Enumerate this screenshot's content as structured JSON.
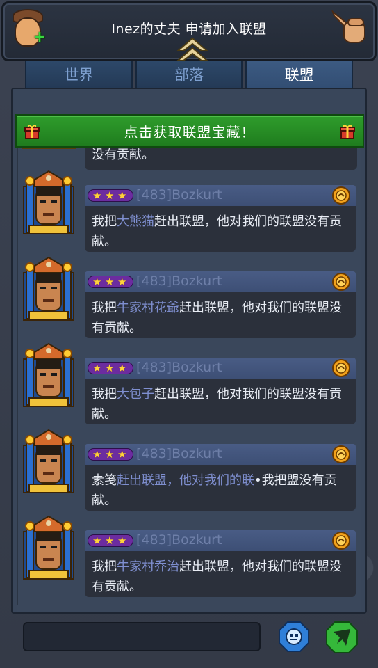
{
  "header": {
    "title": "Inez的丈夫 申请加入联盟"
  },
  "tabs": [
    {
      "label": "世界",
      "active": false
    },
    {
      "label": "部落",
      "active": false
    },
    {
      "label": "联盟",
      "active": true
    }
  ],
  "banner": {
    "label": "点击获取联盟宝藏！"
  },
  "partial_message": {
    "text": "没有贡献。"
  },
  "messages": [
    {
      "sender": "[483]Bozkurt",
      "stars": 3,
      "prefix": "我把",
      "highlight": "大熊猫",
      "suffix": "赶出联盟，他对我们的联盟没有贡献。"
    },
    {
      "sender": "[483]Bozkurt",
      "stars": 3,
      "prefix": "我把",
      "highlight": "牛家村花爺",
      "suffix": "赶出联盟，他对我们的联盟没有贡献。"
    },
    {
      "sender": "[483]Bozkurt",
      "stars": 3,
      "prefix": "我把",
      "highlight": "大包子",
      "suffix": "赶出联盟，他对我们的联盟没有贡献。"
    },
    {
      "sender": "[483]Bozkurt",
      "stars": 3,
      "prefix": "素笺",
      "highlight": "赶出联盟，他对我们的联",
      "suffix": "•我把盟没有贡献。"
    },
    {
      "sender": "[483]Bozkurt",
      "stars": 3,
      "prefix": "我把",
      "highlight": "牛家村乔治",
      "suffix": "赶出联盟，他对我们的联盟没有贡献。"
    }
  ],
  "input": {
    "value": "",
    "placeholder": ""
  },
  "colors": {
    "banner_green": "#2f9d2c",
    "name_bar": "#495c85",
    "star_badge": "#6c2ca0",
    "highlight_name": "#7f8fd0",
    "active_tab": "#3c5a82"
  },
  "icons": {
    "avatar": "add-friend-avatar-icon",
    "collapse": "double-chevron-up-icon",
    "menu": "pointing-hand-icon",
    "gift": "gift-box-icon",
    "medal": "rank-medal-icon",
    "emoji": "emoji-face-icon",
    "send": "send-arrow-icon"
  }
}
